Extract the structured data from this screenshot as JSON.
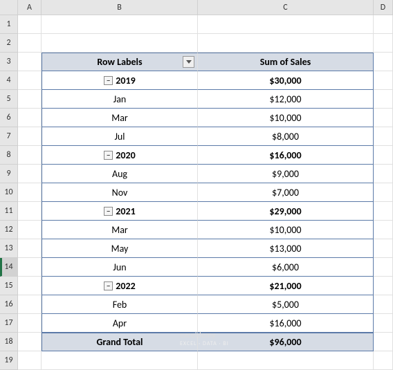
{
  "columns": [
    "A",
    "B",
    "C",
    "D"
  ],
  "rows": [
    "1",
    "2",
    "3",
    "4",
    "5",
    "6",
    "7",
    "8",
    "9",
    "10",
    "11",
    "12",
    "13",
    "14",
    "15",
    "16",
    "17",
    "18",
    "19"
  ],
  "pivot": {
    "rowLabels": "Row Labels",
    "sumOfSales": "Sum of Sales",
    "grandTotal": "Grand Total",
    "grandTotalValue": "$96,000",
    "groups": [
      {
        "year": "2019",
        "subtotal": "$30,000",
        "rows": [
          {
            "month": "Jan",
            "value": "$12,000"
          },
          {
            "month": "Mar",
            "value": "$10,000"
          },
          {
            "month": "Jul",
            "value": "$8,000"
          }
        ]
      },
      {
        "year": "2020",
        "subtotal": "$16,000",
        "rows": [
          {
            "month": "Aug",
            "value": "$9,000"
          },
          {
            "month": "Nov",
            "value": "$7,000"
          }
        ]
      },
      {
        "year": "2021",
        "subtotal": "$29,000",
        "rows": [
          {
            "month": "Mar",
            "value": "$10,000"
          },
          {
            "month": "May",
            "value": "$13,000"
          },
          {
            "month": "Jun",
            "value": "$6,000"
          }
        ]
      },
      {
        "year": "2022",
        "subtotal": "$21,000",
        "rows": [
          {
            "month": "Feb",
            "value": "$5,000"
          },
          {
            "month": "Apr",
            "value": "$16,000"
          }
        ]
      }
    ]
  },
  "watermark": {
    "line1": "exceldemy",
    "line2": "EXCEL · DATA · BI"
  },
  "collapseGlyph": "−"
}
